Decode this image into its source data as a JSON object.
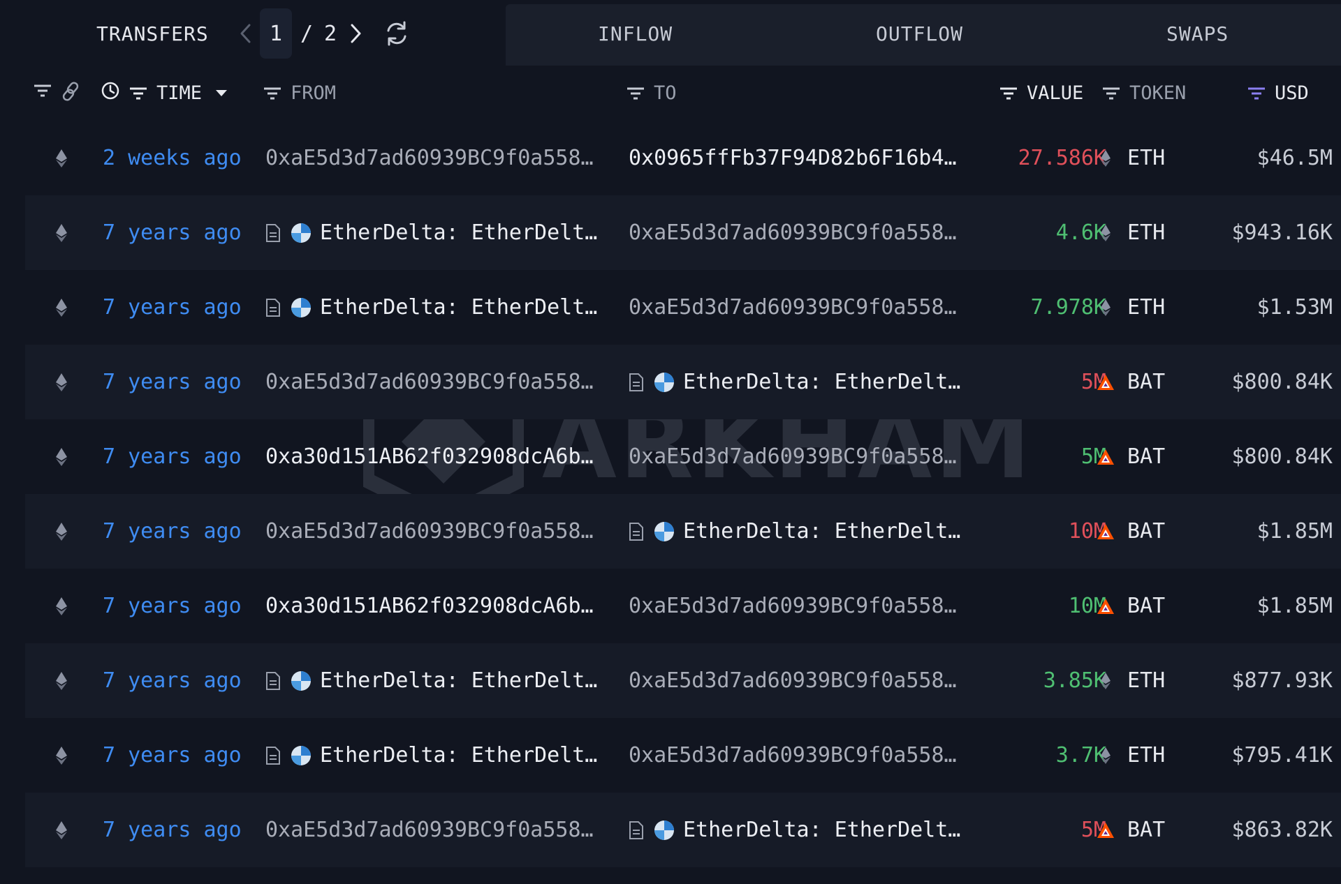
{
  "topbar": {
    "transfers_label": "TRANSFERS",
    "page_current": "1",
    "page_separator": "/",
    "page_total": "2",
    "tabs": [
      "INFLOW",
      "OUTFLOW",
      "SWAPS"
    ]
  },
  "columns": {
    "time": "TIME",
    "from": "FROM",
    "to": "TO",
    "value": "VALUE",
    "token": "TOKEN",
    "usd": "USD"
  },
  "watermark": {
    "text": "ARKHAM"
  },
  "colors": {
    "background": "#111520",
    "time_link": "#3f8cf2",
    "value_in": "#4fbf72",
    "value_out": "#e0505a",
    "usd_filter_accent": "#8b7ff0"
  },
  "rows": [
    {
      "time": "2 weeks ago",
      "from": "0xaE5d3d7ad60939BC9f0a558…",
      "to": "0x0965ffFb37F94D82b6F16b4…",
      "value": "27.586K",
      "token": "ETH",
      "usd": "$46.5M"
    },
    {
      "time": "7 years ago",
      "from": "EtherDelta: EtherDelt…",
      "to": "0xaE5d3d7ad60939BC9f0a558…",
      "value": "4.6K",
      "token": "ETH",
      "usd": "$943.16K"
    },
    {
      "time": "7 years ago",
      "from": "EtherDelta: EtherDelt…",
      "to": "0xaE5d3d7ad60939BC9f0a558…",
      "value": "7.978K",
      "token": "ETH",
      "usd": "$1.53M"
    },
    {
      "time": "7 years ago",
      "from": "0xaE5d3d7ad60939BC9f0a558…",
      "to": "EtherDelta: EtherDelt…",
      "value": "5M",
      "token": "BAT",
      "usd": "$800.84K"
    },
    {
      "time": "7 years ago",
      "from": "0xa30d151AB62f032908dcA6b…",
      "to": "0xaE5d3d7ad60939BC9f0a558…",
      "value": "5M",
      "token": "BAT",
      "usd": "$800.84K"
    },
    {
      "time": "7 years ago",
      "from": "0xaE5d3d7ad60939BC9f0a558…",
      "to": "EtherDelta: EtherDelt…",
      "value": "10M",
      "token": "BAT",
      "usd": "$1.85M"
    },
    {
      "time": "7 years ago",
      "from": "0xa30d151AB62f032908dcA6b…",
      "to": "0xaE5d3d7ad60939BC9f0a558…",
      "value": "10M",
      "token": "BAT",
      "usd": "$1.85M"
    },
    {
      "time": "7 years ago",
      "from": "EtherDelta: EtherDelt…",
      "to": "0xaE5d3d7ad60939BC9f0a558…",
      "value": "3.85K",
      "token": "ETH",
      "usd": "$877.93K"
    },
    {
      "time": "7 years ago",
      "from": "EtherDelta: EtherDelt…",
      "to": "0xaE5d3d7ad60939BC9f0a558…",
      "value": "3.7K",
      "token": "ETH",
      "usd": "$795.41K"
    },
    {
      "time": "7 years ago",
      "from": "0xaE5d3d7ad60939BC9f0a558…",
      "to": "EtherDelta: EtherDelt…",
      "value": "5M",
      "token": "BAT",
      "usd": "$863.82K"
    }
  ]
}
